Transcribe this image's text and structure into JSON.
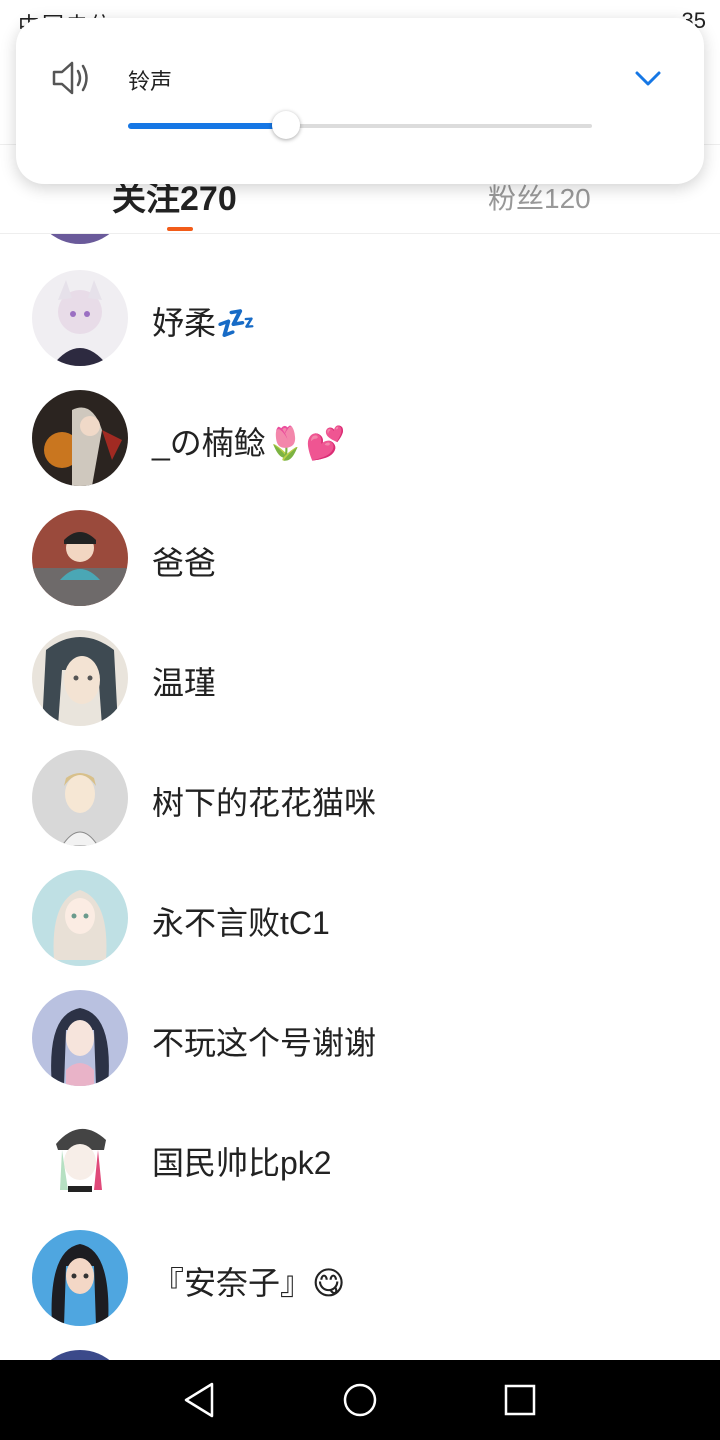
{
  "status_bar": {
    "left_text": "中国电信 ",
    "right_text": "35"
  },
  "volume_panel": {
    "speaker_icon": "speaker-icon",
    "label": "铃声",
    "level": 0.34,
    "expand_icon": "chevron-down-icon",
    "accent_color": "#1677e5"
  },
  "tabs": {
    "following": "关注270",
    "fans": "粉丝120",
    "active_underline_color": "#f25c19"
  },
  "list": {
    "items": [
      {
        "name": "妤柔💤"
      },
      {
        "name": "_の楠鲶🌷💕"
      },
      {
        "name": "爸爸"
      },
      {
        "name": "温瑾"
      },
      {
        "name": "树下的花花猫咪"
      },
      {
        "name": "永不言败tC1"
      },
      {
        "name": "不玩这个号谢谢"
      },
      {
        "name": "国民帅比pk2"
      },
      {
        "name": "『安奈子』😋"
      }
    ]
  },
  "nav_bar": {
    "back_icon": "back-triangle-icon",
    "home_icon": "home-circle-icon",
    "recent_icon": "recent-square-icon"
  }
}
